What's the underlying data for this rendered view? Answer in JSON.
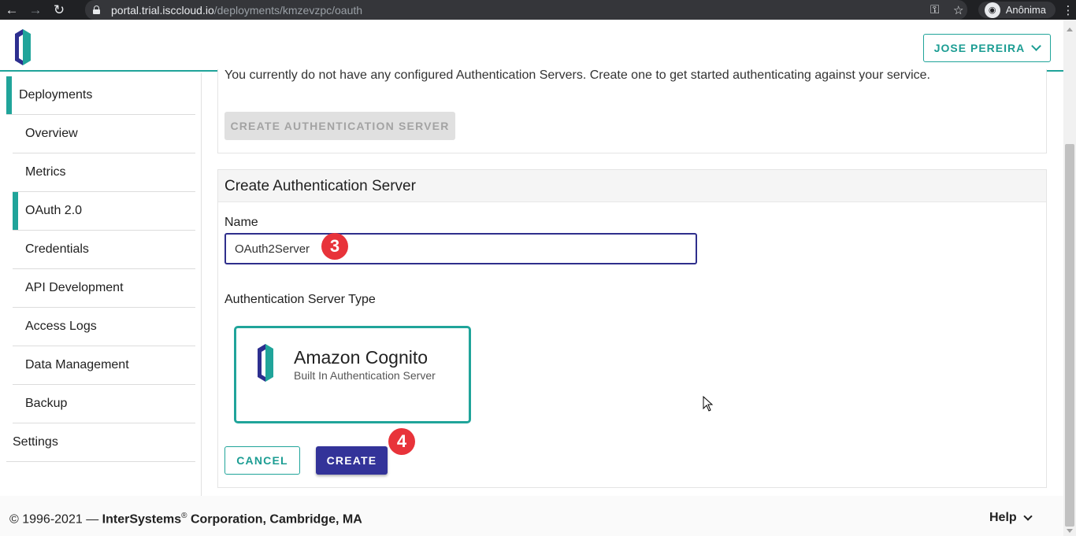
{
  "browser": {
    "url_host": "portal.trial.isccloud.io",
    "url_path": "/deployments/kmzevzpc/oauth",
    "profile_label": "Anônima"
  },
  "header": {
    "user_button_label": "JOSE PEREIRA"
  },
  "sidebar": {
    "items": [
      {
        "label": "Deployments",
        "level": "top",
        "active": true
      },
      {
        "label": "Overview",
        "level": "sub",
        "active": false
      },
      {
        "label": "Metrics",
        "level": "sub",
        "active": false
      },
      {
        "label": "OAuth 2.0",
        "level": "sub",
        "active": true
      },
      {
        "label": "Credentials",
        "level": "sub",
        "active": false
      },
      {
        "label": "API Development",
        "level": "sub",
        "active": false
      },
      {
        "label": "Access Logs",
        "level": "sub",
        "active": false
      },
      {
        "label": "Data Management",
        "level": "sub",
        "active": false
      },
      {
        "label": "Backup",
        "level": "sub",
        "active": false
      },
      {
        "label": "Settings",
        "level": "top",
        "active": false
      }
    ]
  },
  "main": {
    "empty_message": "You currently do not have any configured Authentication Servers. Create one to get started authenticating against your service.",
    "create_server_button": "CREATE AUTHENTICATION SERVER",
    "form": {
      "title": "Create Authentication Server",
      "name_label": "Name",
      "name_value": "OAuth2Server",
      "type_label": "Authentication Server Type",
      "type_option": {
        "title": "Amazon Cognito",
        "subtitle": "Built In Authentication Server",
        "selected": true
      },
      "cancel_label": "CANCEL",
      "create_label": "CREATE"
    },
    "step_badges": [
      "3",
      "4"
    ]
  },
  "footer": {
    "copyright_prefix": "© 1996-2021 — ",
    "company": "InterSystems",
    "registered": "®",
    "copyright_suffix": " Corporation, Cambridge, MA",
    "help_label": "Help"
  },
  "colors": {
    "accent_teal": "#20a49a",
    "primary_indigo": "#333399",
    "badge_red": "#e8333a"
  }
}
